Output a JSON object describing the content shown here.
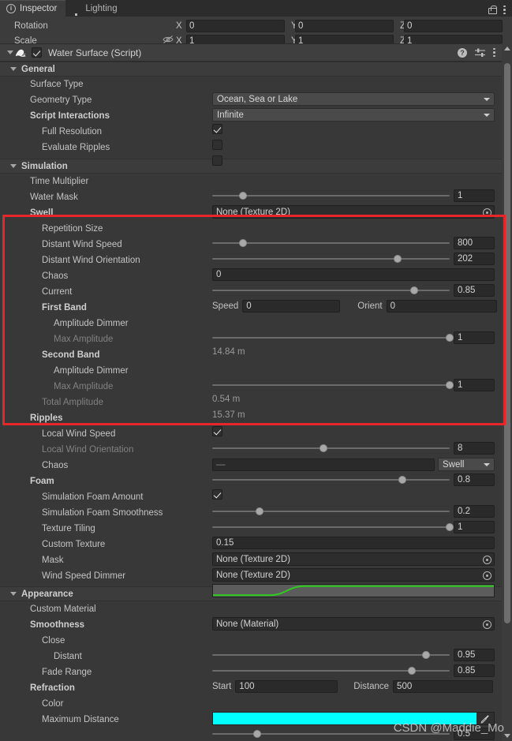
{
  "window": {
    "tabs": [
      {
        "label": "Inspector",
        "icon": "info-icon",
        "active": true
      },
      {
        "label": "Lighting",
        "icon": "light-bulb-icon",
        "active": false
      }
    ],
    "lock_icon": "lock-icon",
    "menu_icon": "kebab-menu-icon"
  },
  "transform": {
    "rows": [
      {
        "label": "Rotation",
        "x": "0",
        "y": "0",
        "z": "0",
        "has_eye": false
      },
      {
        "label": "Scale",
        "x": "1",
        "y": "1",
        "z": "1",
        "has_eye": true
      }
    ],
    "axis_x": "X",
    "axis_y": "Y",
    "axis_z": "Z"
  },
  "component": {
    "title": "Water Surface (Script)",
    "enabled": true,
    "script_icon": "water-script-icon",
    "help_icon": "help-icon",
    "preset_icon": "preset-icon",
    "menu_icon": "kebab-menu-icon"
  },
  "sections": {
    "general": {
      "title": "General",
      "surface_type_label": "Surface Type",
      "surface_type_value": "Ocean, Sea or Lake",
      "geometry_type_label": "Geometry Type",
      "geometry_type_value": "Infinite",
      "script_interactions_label": "Script Interactions",
      "script_interactions_checked": true,
      "full_resolution_label": "Full Resolution",
      "full_resolution_checked": false,
      "evaluate_ripples_label": "Evaluate Ripples",
      "evaluate_ripples_checked": false
    },
    "simulation": {
      "title": "Simulation",
      "time_multiplier_label": "Time Multiplier",
      "time_multiplier_value": "1",
      "time_multiplier_pct": 13,
      "water_mask_label": "Water Mask",
      "water_mask_value": "None (Texture 2D)",
      "swell": {
        "title": "Swell",
        "repetition_size_label": "Repetition Size",
        "repetition_size_value": "800",
        "repetition_size_pct": 13,
        "distant_wind_speed_label": "Distant Wind Speed",
        "distant_wind_speed_value": "202",
        "distant_wind_speed_pct": 78,
        "distant_wind_orientation_label": "Distant Wind Orientation",
        "distant_wind_orientation_value": "0",
        "chaos_label": "Chaos",
        "chaos_value": "0.85",
        "chaos_pct": 85,
        "current_label": "Current",
        "current_speed_label": "Speed",
        "current_speed_value": "0",
        "current_orient_label": "Orient",
        "current_orient_value": "0",
        "first_band": {
          "title": "First Band",
          "amplitude_dimmer_label": "Amplitude Dimmer",
          "amplitude_dimmer_value": "1",
          "amplitude_dimmer_pct": 100,
          "max_amplitude_label": "Max Amplitude",
          "max_amplitude_value": "14.84 m"
        },
        "second_band": {
          "title": "Second Band",
          "amplitude_dimmer_label": "Amplitude Dimmer",
          "amplitude_dimmer_value": "1",
          "amplitude_dimmer_pct": 100,
          "max_amplitude_label": "Max Amplitude",
          "max_amplitude_value": "0.54 m"
        },
        "total_amplitude_label": "Total Amplitude",
        "total_amplitude_value": "15.37 m"
      },
      "ripples": {
        "title": "Ripples",
        "checked": true,
        "local_wind_speed_label": "Local Wind Speed",
        "local_wind_speed_value": "8",
        "local_wind_speed_pct": 47,
        "local_wind_orientation_label": "Local Wind Orientation",
        "local_wind_orientation_value": "—",
        "local_wind_orientation_mode": "Swell",
        "chaos_label": "Chaos",
        "chaos_value": "0.8",
        "chaos_pct": 80
      },
      "foam": {
        "title": "Foam",
        "checked": true,
        "simulation_foam_amount_label": "Simulation Foam Amount",
        "simulation_foam_amount_value": "0.2",
        "simulation_foam_amount_pct": 20,
        "simulation_foam_smoothness_label": "Simulation Foam Smoothness",
        "simulation_foam_smoothness_value": "1",
        "simulation_foam_smoothness_pct": 100,
        "texture_tiling_label": "Texture Tiling",
        "texture_tiling_value": "0.15",
        "custom_texture_label": "Custom Texture",
        "custom_texture_value": "None (Texture 2D)",
        "mask_label": "Mask",
        "mask_value": "None (Texture 2D)",
        "wind_speed_dimmer_label": "Wind Speed Dimmer",
        "wind_speed_dimmer_curve_color": "#2ecc1e"
      }
    },
    "appearance": {
      "title": "Appearance",
      "custom_material_label": "Custom Material",
      "custom_material_value": "None (Material)",
      "smoothness": {
        "title": "Smoothness",
        "close_label": "Close",
        "close_value": "0.95",
        "close_pct": 90,
        "distant_label": "Distant",
        "distant_value": "0.85",
        "distant_pct": 84,
        "fade_range_label": "Fade Range",
        "fade_start_label": "Start",
        "fade_start_value": "100",
        "fade_distance_label": "Distance",
        "fade_distance_value": "500"
      },
      "refraction": {
        "title": "Refraction",
        "color_label": "Color",
        "color_value": "#00FFFF",
        "eyedropper_icon": "eyedropper-icon",
        "maximum_distance_label": "Maximum Distance",
        "maximum_distance_value": "0.5",
        "maximum_distance_pct": 19
      }
    }
  },
  "annotation": {
    "highlight_color": "#e8262a",
    "watermark": "CSDN @Maddie_Mo"
  },
  "scrollbar": {
    "up_icon": "scroll-up-arrow-icon",
    "down_icon": "scroll-down-arrow-icon"
  }
}
